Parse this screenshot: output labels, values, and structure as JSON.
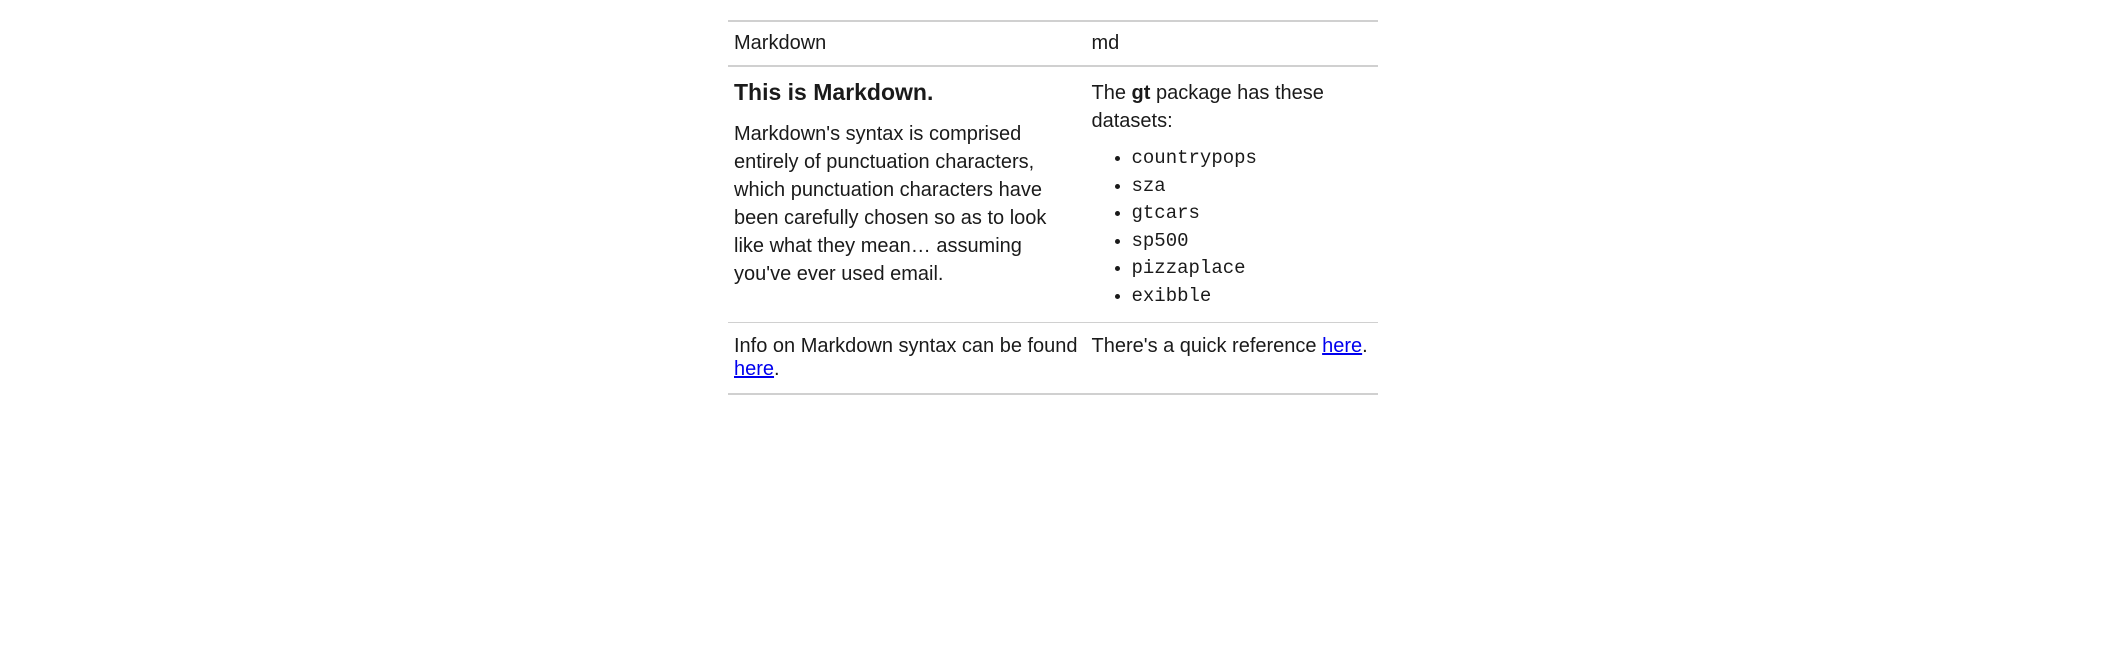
{
  "headers": {
    "col1": "Markdown",
    "col2": "md"
  },
  "row1": {
    "left": {
      "heading": "This is Markdown.",
      "paragraph": "Markdown's syntax is comprised entirely of punctuation characters, which punctuation characters have been carefully chosen so as to look like what they mean… assuming you've ever used email."
    },
    "right": {
      "intro_prefix": "The ",
      "intro_bold": "gt",
      "intro_suffix": " package has these datasets:",
      "datasets": [
        "countrypops",
        "sza",
        "gtcars",
        "sp500",
        "pizzaplace",
        "exibble"
      ]
    }
  },
  "row2": {
    "left": {
      "text_before": "Info on Markdown syntax can be found ",
      "link_text": "here",
      "text_after": "."
    },
    "right": {
      "text_before": "There's a quick reference ",
      "link_text": "here",
      "text_after": "."
    }
  }
}
